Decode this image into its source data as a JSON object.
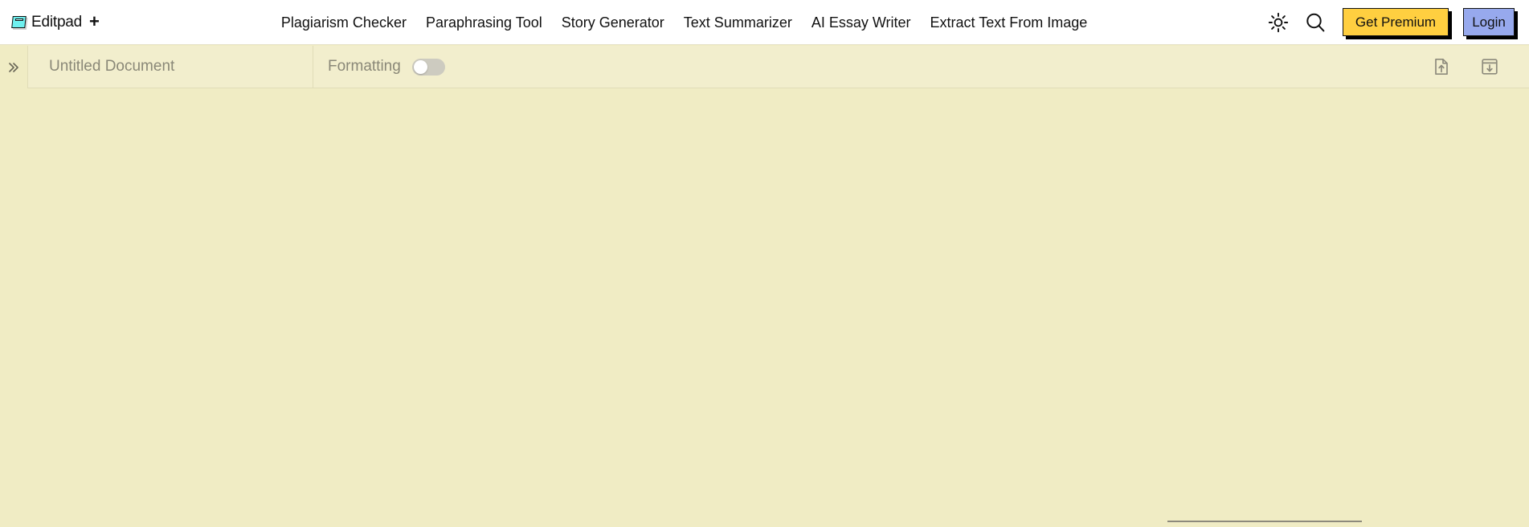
{
  "brand": {
    "name": "Editpad",
    "plus": "+",
    "icon": "notebook-icon"
  },
  "nav": {
    "links": [
      {
        "label": "Plagiarism Checker"
      },
      {
        "label": "Paraphrasing Tool"
      },
      {
        "label": "Story Generator"
      },
      {
        "label": "Text Summarizer"
      },
      {
        "label": "AI Essay Writer"
      },
      {
        "label": "Extract Text From Image"
      }
    ],
    "theme_icon": "sun-icon",
    "search_icon": "search-icon",
    "premium_label": "Get Premium",
    "login_label": "Login",
    "premium_color": "#ffcf40",
    "login_color": "#97a9ed"
  },
  "toolbar": {
    "collapse_icon": "chevron-double-right-icon",
    "document_title_value": "",
    "document_title_placeholder": "Untitled Document",
    "formatting_label": "Formatting",
    "formatting_enabled": false,
    "upload_icon": "file-upload-icon",
    "download_icon": "file-download-icon"
  },
  "editor": {
    "content": "",
    "placeholder": ""
  },
  "colors": {
    "page_background": "#f0ecc4",
    "nav_background": "#ffffff",
    "toolbar_background": "#f2eecd",
    "muted_text": "#8a8878"
  }
}
